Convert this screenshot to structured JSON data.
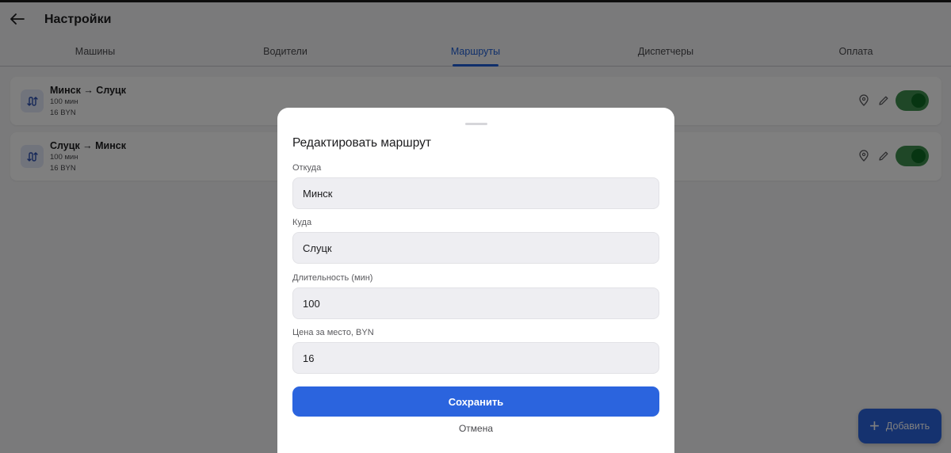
{
  "header": {
    "title": "Настройки"
  },
  "tabs": [
    {
      "label": "Машины"
    },
    {
      "label": "Водители"
    },
    {
      "label": "Маршруты"
    },
    {
      "label": "Диспетчеры"
    },
    {
      "label": "Оплата"
    }
  ],
  "routes": [
    {
      "name": "Минск → Слуцк",
      "duration": "100 мин",
      "price": "16 BYN",
      "enabled": true
    },
    {
      "name": "Слуцк → Минск",
      "duration": "100 мин",
      "price": "16 BYN",
      "enabled": true
    }
  ],
  "add_button": {
    "label": "Добавить"
  },
  "modal": {
    "title": "Редактировать маршрут",
    "from": {
      "label": "Откуда",
      "value": "Минск"
    },
    "to": {
      "label": "Куда",
      "value": "Слуцк"
    },
    "duration": {
      "label": "Длительность (мин)",
      "value": "100"
    },
    "price": {
      "label": "Цена за место, BYN",
      "value": "16"
    },
    "save_label": "Сохранить",
    "cancel_label": "Отмена"
  },
  "colors": {
    "accent": "#2b64de",
    "toggle_on": "#3f8f4f"
  }
}
